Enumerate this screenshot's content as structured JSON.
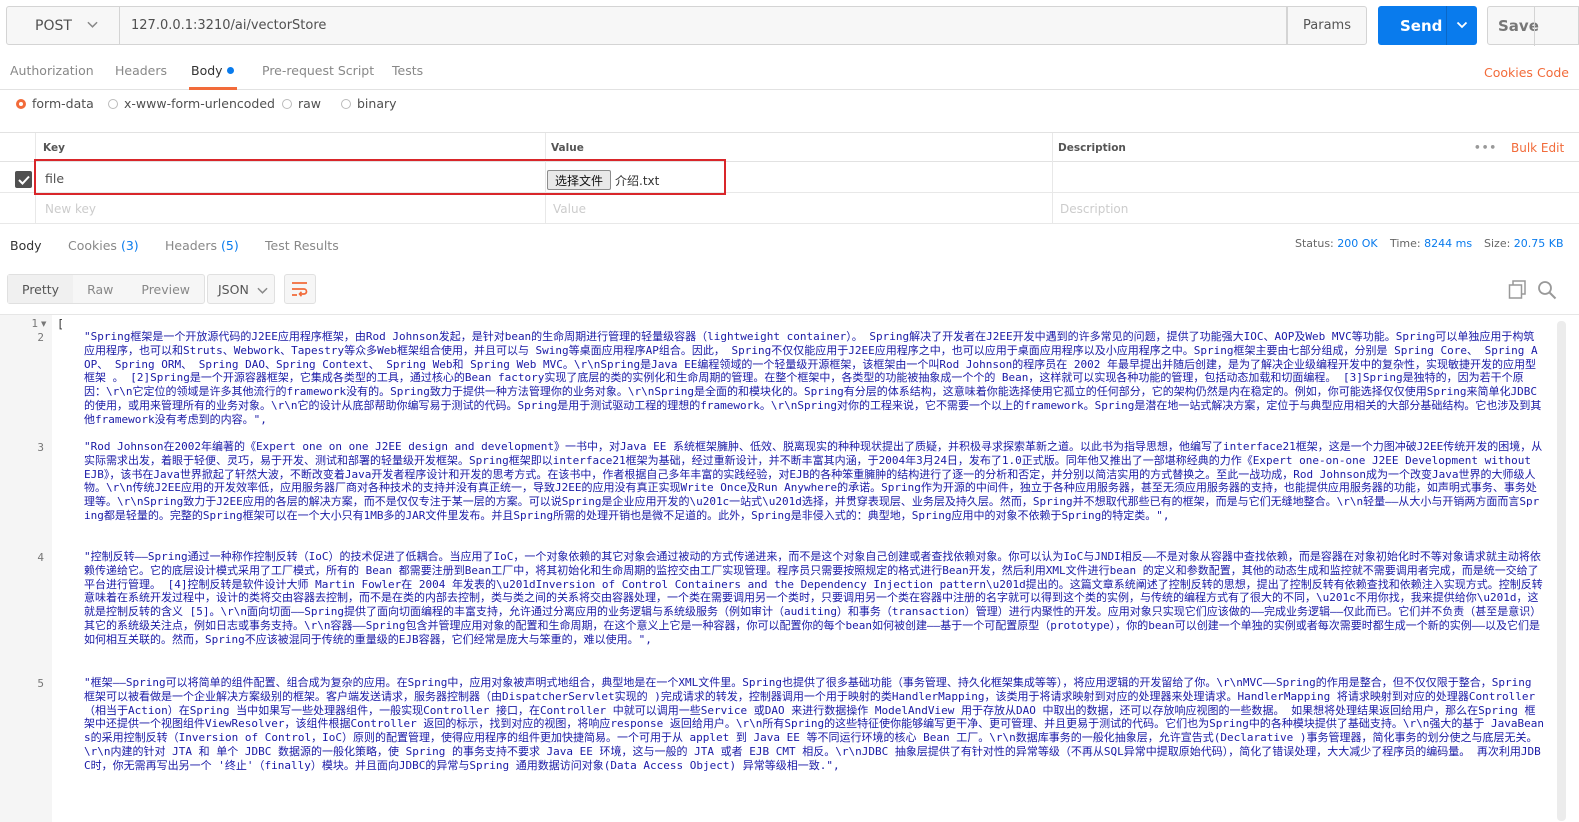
{
  "request": {
    "method": "POST",
    "url": "127.0.0.1:3210/ai/vectorStore",
    "params_label": "Params",
    "send_label": "Send",
    "save_label": "Save"
  },
  "request_tabs": [
    "Authorization",
    "Headers",
    "Body",
    "Pre-request Script",
    "Tests"
  ],
  "request_links": {
    "cookies": "Cookies",
    "code": "Code"
  },
  "body_types": [
    "form-data",
    "x-www-form-urlencoded",
    "raw",
    "binary"
  ],
  "kv_table": {
    "headers": {
      "key": "Key",
      "value": "Value",
      "description": "Description"
    },
    "more": "•••",
    "bulk_edit": "Bulk Edit",
    "row": {
      "key": "file",
      "choose_file": "选择文件",
      "file_name": "介绍.txt"
    },
    "placeholders": {
      "key": "New key",
      "value": "Value",
      "description": "Description"
    }
  },
  "response_tabs": {
    "body": "Body",
    "cookies": "Cookies",
    "cookies_count": "(3)",
    "headers": "Headers",
    "headers_count": "(5)",
    "test_results": "Test Results"
  },
  "response_stats": {
    "status_label": "Status:",
    "status": "200 OK",
    "time_label": "Time:",
    "time": "8244 ms",
    "size_label": "Size:",
    "size": "20.75 KB"
  },
  "view_modes": [
    "Pretty",
    "Raw",
    "Preview"
  ],
  "format": "JSON",
  "colors": {
    "accent": "#f26b3a",
    "primary": "#097bed",
    "string": "#1a1aa6",
    "highlight": "#d9262a"
  },
  "code": {
    "line_numbers": [
      "1",
      "2",
      "3",
      "4",
      "5"
    ],
    "open_bracket": "[",
    "entries": [
      "\"Spring框架是一个开放源代码的J2EE应用程序框架，由Rod Johnson发起，是针对bean的生命周期进行管理的轻量级容器（lightweight container）。 Spring解决了开发者在J2EE开发中遇到的许多常见的问题，提供了功能强大IOC、AOP及Web MVC等功能。Spring可以单独应用于构筑应用程序，也可以和Struts、Webwork、Tapestry等众多Web框架组合使用，并且可以与 Swing等桌面应用程序AP组合。因此， Spring不仅仅能应用于J2EE应用程序之中，也可以应用于桌面应用程序以及小应用程序之中。Spring框架主要由七部分组成，分别是 Spring Core、 Spring AOP、 Spring ORM、 Spring DAO、Spring Context、 Spring Web和 Spring Web MVC。\\r\\nSpring是Java EE编程领域的一个轻量级开源框架，该框架由一个叫Rod Johnson的程序员在 2002 年最早提出并随后创建，是为了解决企业级编程开发中的复杂性，实现敏捷开发的应用型框架 。 [2]Spring是一个开源容器框架，它集成各类型的工具，通过核心的Bean factory实现了底层的类的实例化和生命周期的管理。在整个框架中，各类型的功能被抽象成一个个的 Bean，这样就可以实现各种功能的管理，包括动态加载和切面编程。 [3]Spring是独特的，因为若干个原因：\\r\\n它定位的领域是许多其他流行的framework没有的。Spring致力于提供一种方法管理你的业务对象。\\r\\nSpring是全面的和模块化的。Spring有分层的体系结构，这意味着你能选择使用它孤立的任何部分，它的架构仍然是内在稳定的。例如，你可能选择仅仅使用Spring来简单化JDBC的使用，或用来管理所有的业务对象。\\r\\n它的设计从底部帮助你编写易于测试的代码。Spring是用于测试驱动工程的理想的framework。\\r\\nSpring对你的工程来说，它不需要一个以上的framework。Spring是潜在地一站式解决方案，定位于与典型应用相关的大部分基础结构。它也涉及到其他framework没有考虑到的内容。\",",
      "\"Rod Johnson在2002年编著的《Expert one on one J2EE design and development》一书中，对Java EE 系统框架臃肿、低效、脱离现实的种种现状提出了质疑，并积极寻求探索革新之道。以此书为指导思想，他编写了interface21框架，这是一个力图冲破J2EE传统开发的困境，从实际需求出发，着眼于轻便、灵巧，易于开发、测试和部署的轻量级开发框架。Spring框架即以interface21框架为基础，经过重新设计，并不断丰富其内涵，于2004年3月24日，发布了1.0正式版。同年他又推出了一部堪称经典的力作《Expert one-on-one J2EE Development without EJB》，该书在Java世界掀起了轩然大波，不断改变着Java开发者程序设计和开发的思考方式。在该书中，作者根据自己多年丰富的实践经验，对EJB的各种笨重臃肿的结构进行了逐一的分析和否定，并分别以简洁实用的方式替换之。至此一战功成，Rod Johnson成为一个改变Java世界的大师级人物。\\r\\n传统J2EE应用的开发效率低，应用服务器厂商对各种技术的支持并没有真正统一，导致J2EE的应用没有真正实现Write Once及Run Anywhere的承诺。Spring作为开源的中间件，独立于各种应用服务器，甚至无须应用服务器的支持，也能提供应用服务器的功能，如声明式事务、事务处理等。\\r\\nSpring致力于J2EE应用的各层的解决方案，而不是仅仅专注于某一层的方案。可以说Spring是企业应用开发的\\u201c一站式\\u201d选择，并贯穿表现层、业务层及持久层。然而，Spring并不想取代那些已有的框架，而是与它们无缝地整合。\\r\\n轻量——从大小与开销两方面而言Spring都是轻量的。完整的Spring框架可以在一个大小只有1MB多的JAR文件里发布。并且Spring所需的处理开销也是微不足道的。此外，Spring是非侵入式的：典型地，Spring应用中的对象不依赖于Spring的特定类。\",",
      "\"控制反转——Spring通过一种称作控制反转（IoC）的技术促进了低耦合。当应用了IoC，一个对象依赖的其它对象会通过被动的方式传递进来，而不是这个对象自己创建或者查找依赖对象。你可以认为IoC与JNDI相反——不是对象从容器中查找依赖，而是容器在对象初始化时不等对象请求就主动将依赖传递给它。它的底层设计模式采用了工厂模式，所有的 Bean 都需要注册到Bean工厂中，将其初始化和生命周期的监控交由工厂实现管理。程序员只需要按照规定的格式进行Bean开发，然后利用XML文件进行bean 的定义和参数配置，其他的动态生成和监控就不需要调用者完成，而是统一交给了平台进行管理。 [4]控制反转是软件设计大师 Martin Fowler在 2004 年发表的\\u201dInversion of Control Containers and the Dependency Injection pattern\\u201d提出的。这篇文章系统阐述了控制反转的思想，提出了控制反转有依赖查找和依赖注入实现方式。控制反转意味着在系统开发过程中，设计的类将交由容器去控制，而不是在类的内部去控制，类与类之间的关系将交由容器处理，一个类在需要调用另一个类时，只要调用另一个类在容器中注册的名字就可以得到这个类的实例，与传统的编程方式有了很大的不同，\\u201c不用你找，我来提供给你\\u201d，这就是控制反转的含义 [5]。\\r\\n面向切面——Spring提供了面向切面编程的丰富支持，允许通过分离应用的业务逻辑与系统级服务（例如审计（auditing）和事务（transaction）管理）进行内聚性的开发。应用对象只实现它们应该做的——完成业务逻辑——仅此而已。它们并不负责（甚至是意识）其它的系统级关注点，例如日志或事务支持。\\r\\n容器——Spring包含并管理应用对象的配置和生命周期，在这个意义上它是一种容器，你可以配置你的每个bean如何被创建——基于一个可配置原型（prototype），你的bean可以创建一个单独的实例或者每次需要时都生成一个新的实例——以及它们是如何相互关联的。然而，Spring不应该被混同于传统的重量级的EJB容器，它们经常是庞大与笨重的，难以使用。\",",
      "\"框架——Spring可以将简单的组件配置、组合成为复杂的应用。在Spring中，应用对象被声明式地组合，典型地是在一个XML文件里。Spring也提供了很多基础功能（事务管理、持久化框架集成等等），将应用逻辑的开发留给了你。\\r\\nMVC——Spring的作用是整合，但不仅仅限于整合，Spring 框架可以被看做是一个企业解决方案级别的框架。客户端发送请求，服务器控制器（由DispatcherServlet实现的 )完成请求的转发，控制器调用一个用于映射的类HandlerMapping，该类用于将请求映射到对应的处理器来处理请求。HandlerMapping 将请求映射到对应的处理器Controller（相当于Action）在Spring 当中如果写一些处理器组件，一般实现Controller 接口，在Controller 中就可以调用一些Service 或DAO 来进行数据操作 ModelAndView 用于存放从DAO 中取出的数据，还可以存放响应视图的一些数据。 如果想将处理结果返回给用户，那么在Spring 框架中还提供一个视图组件ViewResolver，该组件根据Controller 返回的标示，找到对应的视图，将响应response 返回给用户。\\r\\n所有Spring的这些特征使你能够编写更干净、更可管理、并且更易于测试的代码。它们也为Spring中的各种模块提供了基础支持。\\r\\n强大的基于 JavaBeans的采用控制反转（Inversion of Control，IoC）原则的配置管理，使得应用程序的组件更加快捷简易。一个可用于从 applet 到 Java EE 等不同运行环境的核心 Bean 工厂。\\r\\n数据库事务的一般化抽象层，允许宣告式(Declarative )事务管理器，简化事务的划分使之与底层无关。\\r\\n内建的针对 JTA 和 单个 JDBC 数据源的一般化策略，使 Spring 的事务支持不要求 Java EE 环境，这与一般的 JTA 或者 EJB CMT 相反。\\r\\nJDBC 抽象层提供了有针对性的异常等级（不再从SQL异常中提取原始代码），简化了错误处理，大大减少了程序员的编码量。 再次利用JDBC时，你无需再写出另一个 '终止'（finally）模块。并且面向JDBC的异常与Spring 通用数据访问对象(Data Access Object) 异常等级相一致.\","
    ]
  }
}
